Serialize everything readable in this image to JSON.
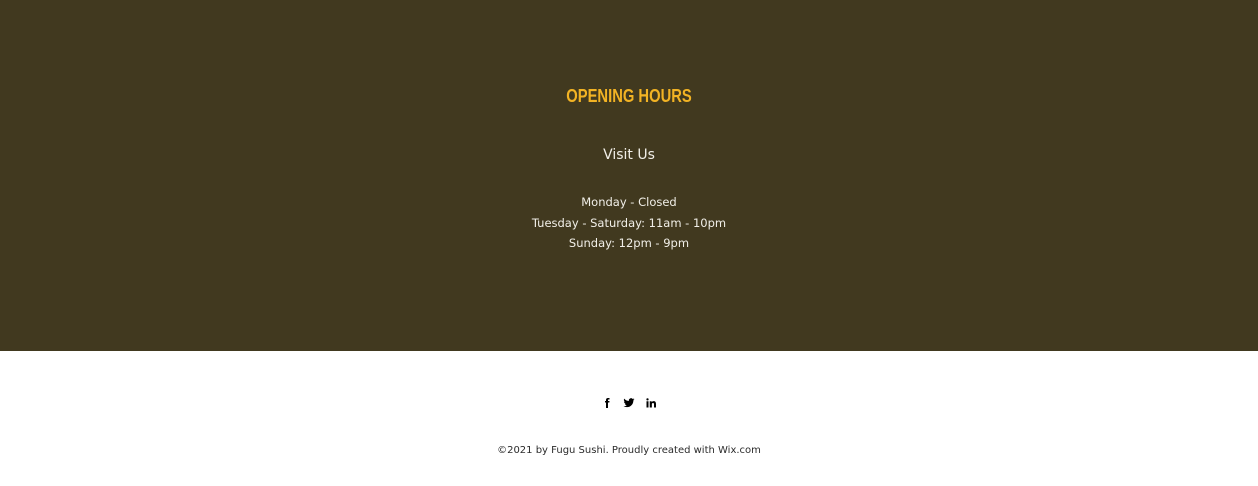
{
  "hours": {
    "title": "OPENING HOURS",
    "subtitle": "Visit Us",
    "lines": [
      "Monday - Closed",
      "Tuesday - Saturday: 11am - 10pm",
      "Sunday: 12pm - 9pm"
    ]
  },
  "colors": {
    "section_background": "#41391f",
    "title_accent": "#f2b324",
    "section_text": "#f1efe8",
    "footer_background": "#ffffff"
  },
  "footer": {
    "social": [
      {
        "icon": "facebook-icon"
      },
      {
        "icon": "twitter-icon"
      },
      {
        "icon": "linkedin-icon"
      }
    ],
    "copyright_prefix": "©2021 by Fugu Sushi. Proudly created with ",
    "copyright_link": "Wix.com"
  }
}
